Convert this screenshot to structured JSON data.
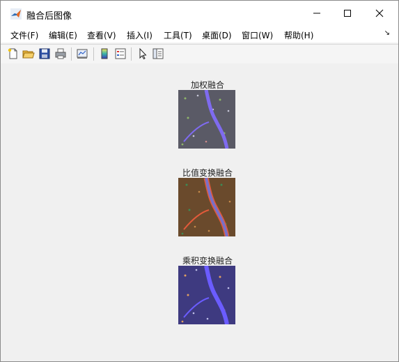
{
  "window": {
    "title": "融合后图像",
    "controls": {
      "minimize_icon": "minimize-icon",
      "maximize_icon": "maximize-icon",
      "close_icon": "close-icon"
    }
  },
  "menu": {
    "items": [
      "文件(F)",
      "编辑(E)",
      "查看(V)",
      "插入(I)",
      "工具(T)",
      "桌面(D)",
      "窗口(W)",
      "帮助(H)"
    ],
    "overflow_icon": "dock-arrow-icon"
  },
  "toolbar": {
    "buttons": [
      "new-figure-icon",
      "open-file-icon",
      "save-icon",
      "print-icon",
      "link-plot-icon",
      "colorbar-icon",
      "legend-icon",
      "pointer-icon",
      "property-editor-icon"
    ]
  },
  "figure": {
    "subplots": [
      {
        "title": "加权融合",
        "variant": "weighted"
      },
      {
        "title": "比值变换融合",
        "variant": "ratio"
      },
      {
        "title": "乘积变换融合",
        "variant": "product"
      }
    ]
  },
  "colors": {
    "weighted_base": "#5a5a66",
    "weighted_river": "#7f6bf0",
    "ratio_base": "#6a4a2c",
    "ratio_river": "#7a70c8",
    "ratio_edge": "#e25a3a",
    "product_base": "#3e3a80",
    "product_river": "#6b5cff"
  }
}
